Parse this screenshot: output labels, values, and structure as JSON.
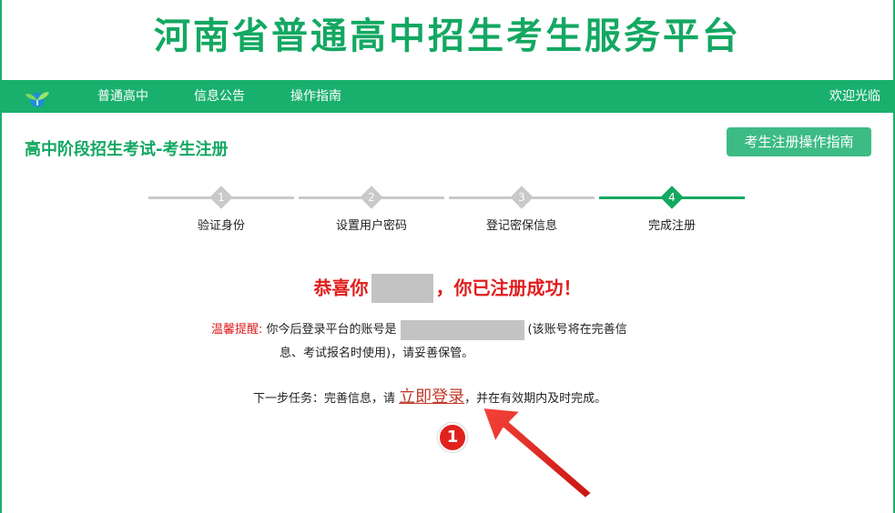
{
  "banner": {
    "title": "河南省普通高中招生考生服务平台"
  },
  "nav": {
    "items": [
      "普通高中",
      "信息公告",
      "操作指南"
    ],
    "welcome": "欢迎光临"
  },
  "page": {
    "title": "高中阶段招生考试-考生注册",
    "guide_button": "考生注册操作指南"
  },
  "steps": [
    {
      "num": "1",
      "label": "验证身份",
      "active": false
    },
    {
      "num": "2",
      "label": "设置用户密码",
      "active": false
    },
    {
      "num": "3",
      "label": "登记密保信息",
      "active": false
    },
    {
      "num": "4",
      "label": "完成注册",
      "active": true
    }
  ],
  "result": {
    "prefix": "恭喜你",
    "suffix": "，你已注册成功！",
    "tip_label": "温馨提醒:",
    "tip_before": "你今后登录平台的账号是",
    "tip_after": "(该账号将在完善信",
    "tip_line2": "息、考试报名时使用)，请妥善保管。",
    "next_before": "下一步任务：完善信息，请",
    "login_link": "立即登录",
    "next_after": "，并在有效期内及时完成。"
  },
  "annotation": {
    "callout_number": "1"
  },
  "colors": {
    "brand_green": "#19b06e",
    "accent_red": "#e01d1d"
  }
}
